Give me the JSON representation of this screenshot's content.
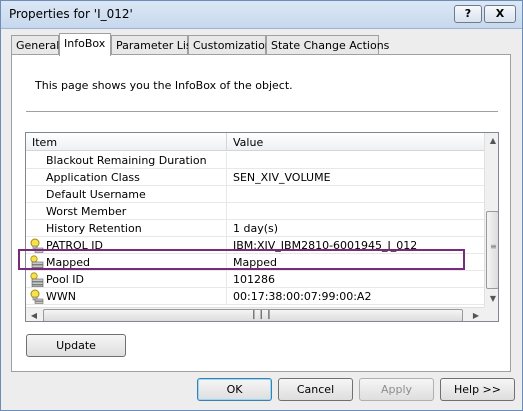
{
  "window": {
    "title": "Properties for 'I_012'",
    "help_button": "?",
    "close_button": "X"
  },
  "tabs": [
    {
      "label": "General",
      "active": false
    },
    {
      "label": "InfoBox",
      "active": true
    },
    {
      "label": "Parameter List",
      "active": false
    },
    {
      "label": "Customization",
      "active": false
    },
    {
      "label": "State Change Actions",
      "active": false
    }
  ],
  "panel": {
    "description": "This page shows you the InfoBox of the object."
  },
  "list": {
    "columns": [
      "Item",
      "Value"
    ],
    "rows": [
      {
        "item": "Blackout Remaining Duration",
        "value": "",
        "icon": "none"
      },
      {
        "item": "Application Class",
        "value": "SEN_XIV_VOLUME",
        "icon": "none"
      },
      {
        "item": "Default Username",
        "value": "",
        "icon": "none"
      },
      {
        "item": "Worst Member",
        "value": "",
        "icon": "none"
      },
      {
        "item": "History Retention",
        "value": "1 day(s)",
        "icon": "none"
      },
      {
        "item": "PATROL ID",
        "value": "IBM:XIV_IBM2810-6001945_I_012",
        "icon": "bulb-icon"
      },
      {
        "item": "Mapped",
        "value": "Mapped",
        "icon": "stack-icon",
        "highlighted": true
      },
      {
        "item": "Pool ID",
        "value": "101286",
        "icon": "stack-icon"
      },
      {
        "item": "WWN",
        "value": "00:17:38:00:07:99:00:A2",
        "icon": "bulb-icon"
      }
    ],
    "highlight_color": "#7a2a7a"
  },
  "update_button": "Update",
  "footer": {
    "ok": "OK",
    "cancel": "Cancel",
    "apply": "Apply",
    "help": "Help >>"
  }
}
